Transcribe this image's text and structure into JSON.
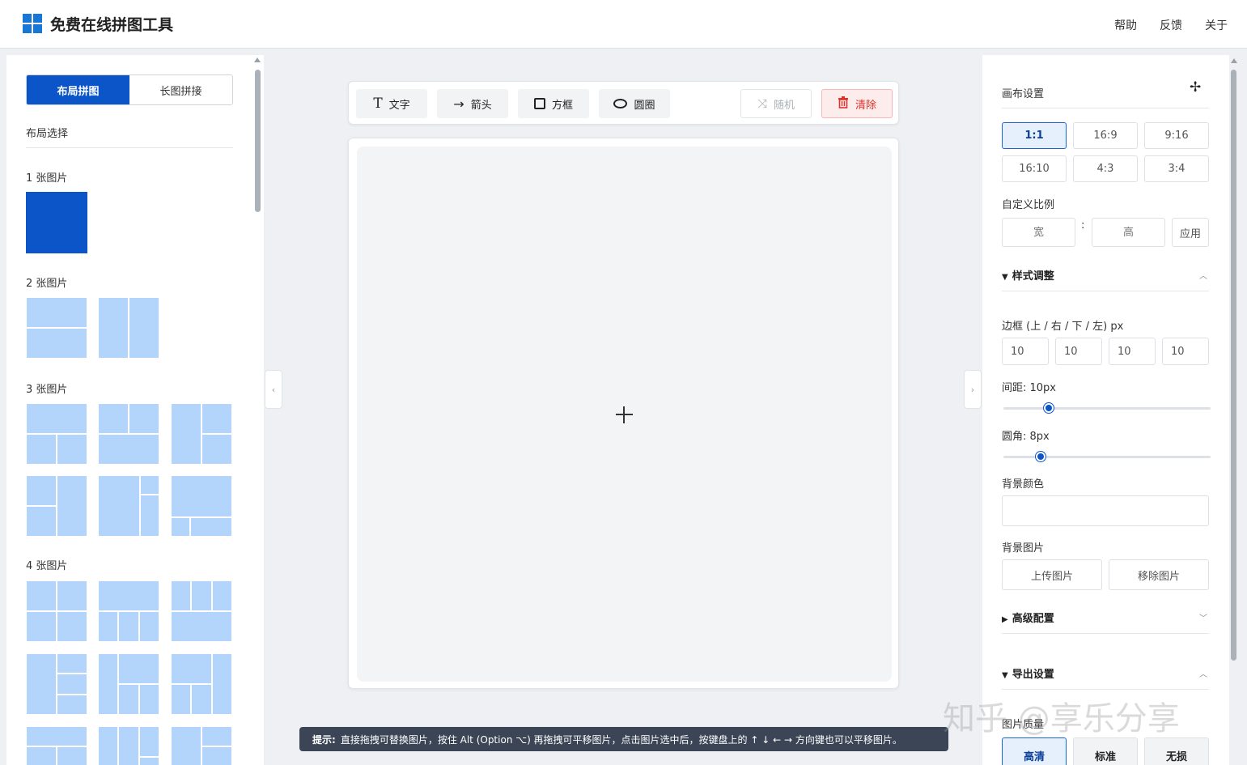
{
  "header": {
    "title": "免费在线拼图工具",
    "nav": [
      "帮助",
      "反馈",
      "关于"
    ]
  },
  "left": {
    "tabs": {
      "active": "布局拼图",
      "inactive": "长图拼接"
    },
    "layout_select": "布局选择",
    "groups": [
      "1 张图片",
      "2 张图片",
      "3 张图片",
      "4 张图片"
    ]
  },
  "toolbar": {
    "text": "文字",
    "arrow": "箭头",
    "box": "方框",
    "circle": "圆圈",
    "random": "随机",
    "clear": "清除"
  },
  "hint": {
    "prefix": "提示:",
    "text": "直接拖拽可替换图片，按住 Alt (Option ⌥) 再拖拽可平移图片，点击图片选中后，按键盘上的 ↑ ↓ ← → 方向键也可以平移图片。"
  },
  "right": {
    "canvas_settings": "画布设置",
    "ratios": [
      "1:1",
      "16:9",
      "9:16",
      "16:10",
      "4:3",
      "3:4"
    ],
    "active_ratio": "1:1",
    "custom_ratio": "自定义比例",
    "width_placeholder": "宽",
    "height_placeholder": "高",
    "colon": ":",
    "apply": "应用",
    "style_section": "样式调整",
    "border_label": "边框 (上 / 右 / 下 / 左) px",
    "borders": [
      "10",
      "10",
      "10",
      "10"
    ],
    "spacing_label": "间距: 10px",
    "spacing_value": 10,
    "radius_label": "圆角: 8px",
    "radius_value": 8,
    "bg_color_label": "背景颜色",
    "bg_image_label": "背景图片",
    "upload_image": "上传图片",
    "remove_image": "移除图片",
    "advanced": "高级配置",
    "export": "导出设置",
    "quality_label": "图片质量",
    "quality_options": [
      "高清",
      "标准",
      "无损"
    ]
  },
  "watermark": "知乎 @享乐分享",
  "colors": {
    "primary": "#0b55c9",
    "tile": "#b3d4fb",
    "danger": "#e0302a"
  }
}
